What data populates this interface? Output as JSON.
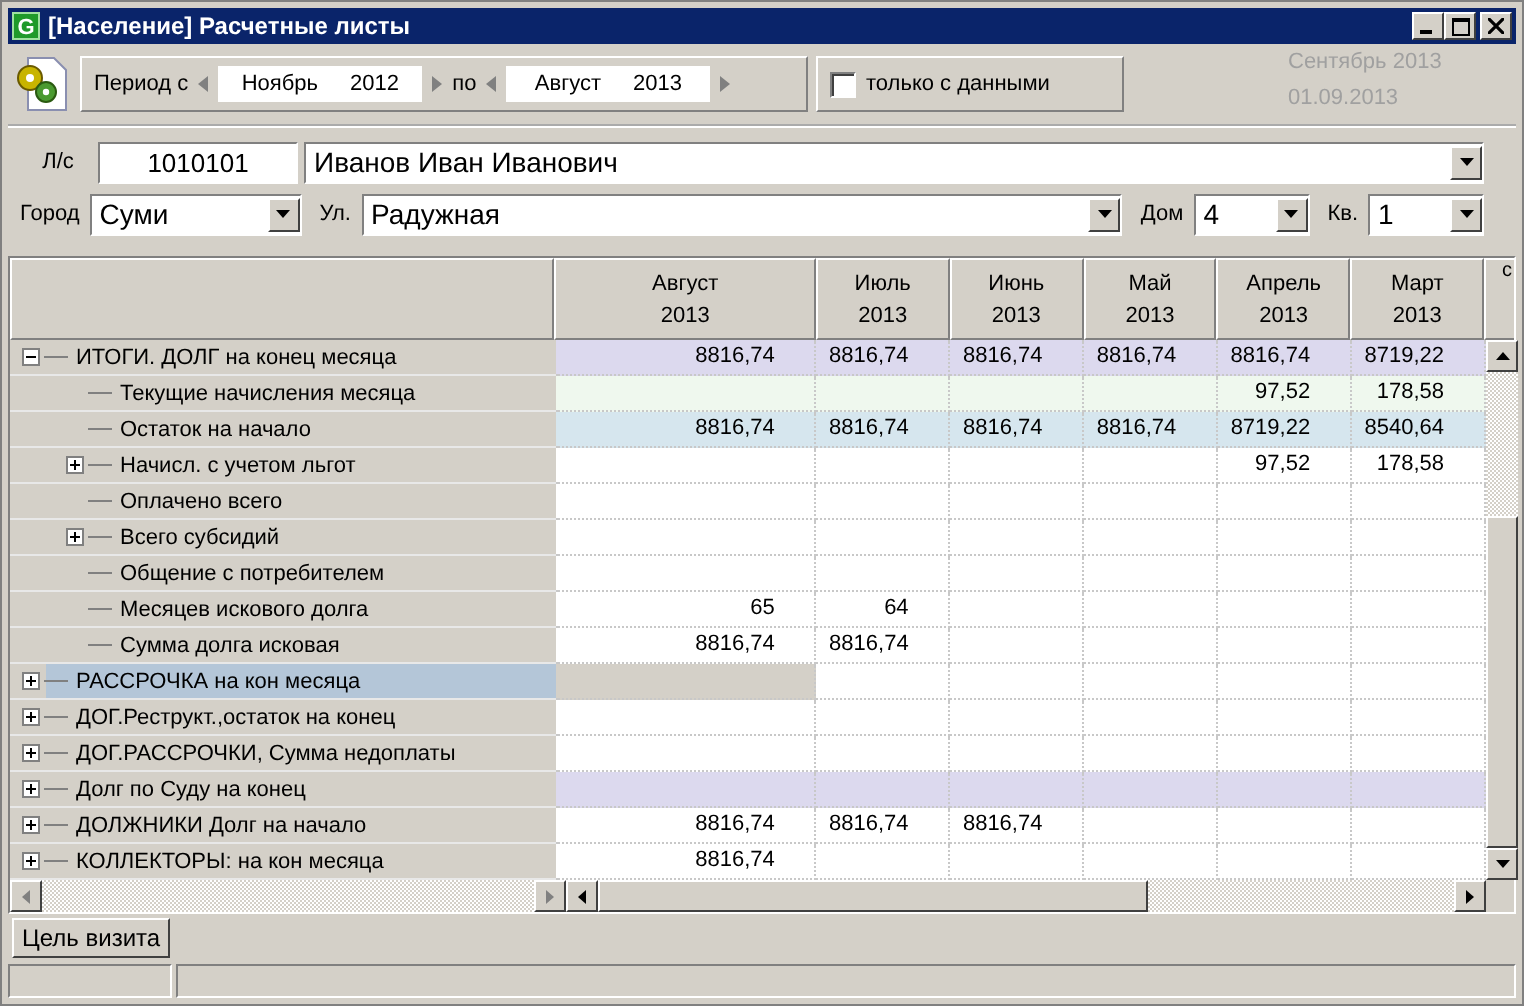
{
  "window": {
    "title": "[Население] Расчетные листы",
    "icon_letter": "G"
  },
  "toolbar": {
    "period_from_label": "Период с",
    "from_month": "Ноябрь",
    "from_year": "2012",
    "period_to_label": "по",
    "to_month": "Август",
    "to_year": "2013",
    "only_with_data": {
      "label": "только с данными",
      "checked": false
    },
    "current_month": "Сентябрь 2013",
    "current_date": "01.09.2013"
  },
  "account": {
    "label": "Л/с",
    "number": "1010101",
    "name": "Иванов Иван Иванович"
  },
  "address": {
    "city_label": "Город",
    "city": "Суми",
    "street_label": "Ул.",
    "street": "Радужная",
    "house_label": "Дом",
    "house": "4",
    "flat_label": "Кв.",
    "flat": "1"
  },
  "table": {
    "columns": [
      {
        "month": "Август",
        "year": "2013"
      },
      {
        "month": "Июль",
        "year": "2013"
      },
      {
        "month": "Июнь",
        "year": "2013"
      },
      {
        "month": "Май",
        "year": "2013"
      },
      {
        "month": "Апрель",
        "year": "2013"
      },
      {
        "month": "Март",
        "year": "2013"
      }
    ],
    "column_7": "с",
    "rows": [
      {
        "label": "ИТОГИ. ДОЛГ на конец месяца",
        "expanded": true,
        "selected": false,
        "color": "#dcd9ee",
        "values": {
          "col_1": "8816,74",
          "col_2": "8816,74",
          "col_3": "8816,74",
          "col_4": "8816,74",
          "col_5": "8816,74",
          "col_6": "8719,22"
        },
        "children": [
          {
            "label": "Текущие начисления месяца",
            "selected": false,
            "color": "#eff8ee",
            "values": {
              "col_5": "97,52",
              "col_6": "178,58"
            }
          },
          {
            "label": "Остаток на начало",
            "selected": false,
            "color": "#d6e6ee",
            "values": {
              "col_1": "8816,74",
              "col_2": "8816,74",
              "col_3": "8816,74",
              "col_4": "8816,74",
              "col_5": "8719,22",
              "col_6": "8540,64"
            }
          },
          {
            "label": "Начисл. с учетом льгот",
            "expanded": false,
            "selected": false,
            "values": {
              "col_5": "97,52",
              "col_6": "178,58"
            }
          },
          {
            "label": "Оплачено всего",
            "selected": false
          },
          {
            "label": "Всего субсидий",
            "expanded": false,
            "selected": false
          },
          {
            "label": "Общение с потребителем",
            "selected": false
          },
          {
            "label": "Месяцев искового долга",
            "selected": false,
            "values": {
              "col_1": "65",
              "col_2": "64"
            }
          },
          {
            "label": "Сумма долга исковая",
            "selected": false,
            "values": {
              "col_1": "8816,74",
              "col_2": "8816,74"
            }
          }
        ]
      },
      {
        "label": "РАССРОЧКА на кон месяца",
        "expanded": false,
        "selected": true
      },
      {
        "label": "ДОГ.Реструкт.,остаток на конец",
        "expanded": false,
        "selected": false
      },
      {
        "label": "ДОГ.РАССРОЧКИ, Сумма недоплаты",
        "expanded": false,
        "selected": false
      },
      {
        "label": "Долг по Суду на конец",
        "expanded": false,
        "selected": false,
        "color": "#dcd9ee"
      },
      {
        "label": "ДОЛЖНИКИ Долг на начало",
        "expanded": false,
        "selected": false,
        "values": {
          "col_1": "8816,74",
          "col_2": "8816,74",
          "col_3": "8816,74"
        }
      },
      {
        "label": "КОЛЛЕКТОРЫ: на кон месяца",
        "expanded": false,
        "selected": false,
        "values": {
          "col_1": "8816,74"
        }
      }
    ]
  },
  "bottom_tabs": [
    {
      "label": "Цель визита"
    }
  ]
}
